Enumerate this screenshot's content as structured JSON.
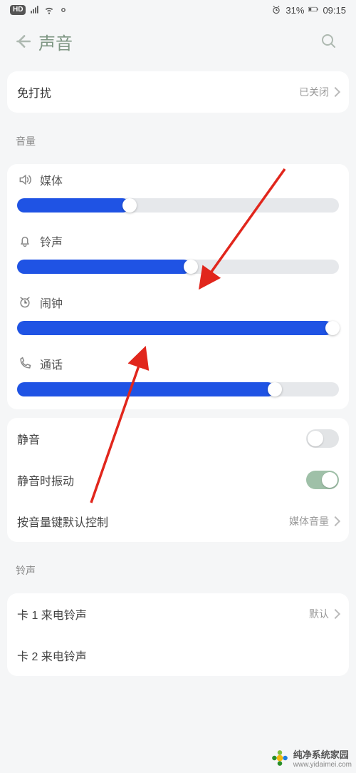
{
  "status_bar": {
    "hd_label": "HD",
    "battery_pct": "31%",
    "time": "09:15"
  },
  "header": {
    "title": "声音"
  },
  "dnd": {
    "label": "免打扰",
    "value": "已关闭"
  },
  "volume_section_label": "音量",
  "volume": {
    "media": {
      "label": "媒体",
      "percent": 35
    },
    "ring": {
      "label": "铃声",
      "percent": 54
    },
    "alarm": {
      "label": "闹钟",
      "percent": 98
    },
    "call": {
      "label": "通话",
      "percent": 80
    }
  },
  "toggles": {
    "mute": {
      "label": "静音",
      "on": false
    },
    "vibrate_mute": {
      "label": "静音时振动",
      "on": true
    }
  },
  "vol_key": {
    "label": "按音量键默认控制",
    "value": "媒体音量"
  },
  "ringtone_section_label": "铃声",
  "ringtones": {
    "sim1": {
      "label": "卡 1 来电铃声",
      "value": "默认"
    },
    "sim2": {
      "label": "卡 2 来电铃声"
    }
  },
  "watermark": {
    "title": "纯净系统家园",
    "url": "www.yidaimei.com"
  }
}
